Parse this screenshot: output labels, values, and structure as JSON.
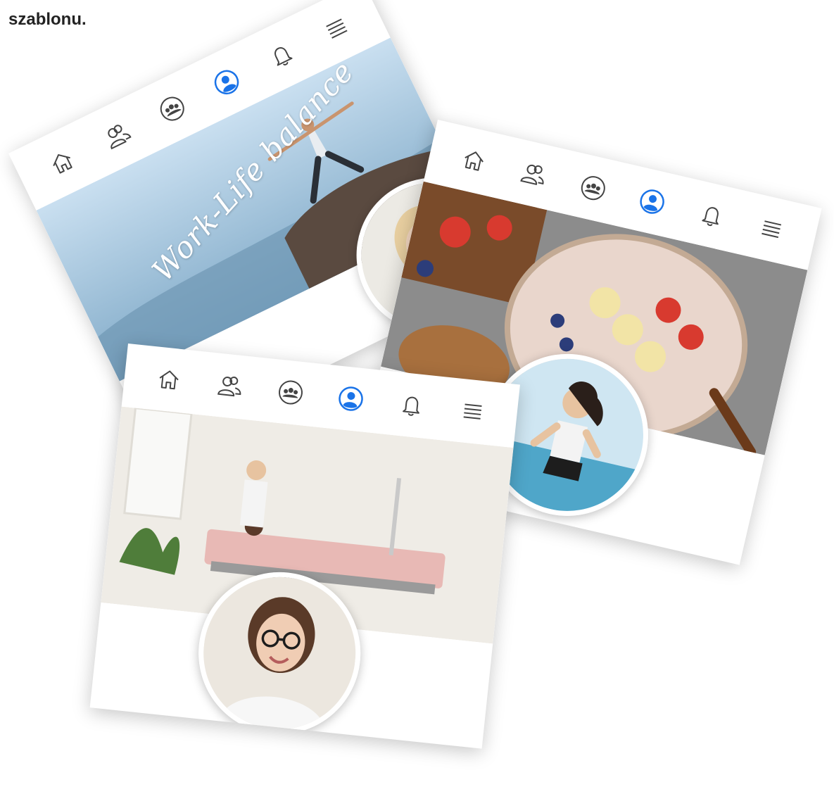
{
  "caption": "szablonu.",
  "colors": {
    "accent": "#1a73e8",
    "icon": "#444444"
  },
  "nav_icons": [
    "home-icon",
    "friends-icon",
    "groups-icon",
    "profile-icon",
    "bell-icon",
    "menu-icon"
  ],
  "cards": [
    {
      "name": "yoga",
      "cover_text": "Work-Life balance",
      "cover": "yoga",
      "avatar": "blonde-woman-with-glasses"
    },
    {
      "name": "food",
      "cover_text": "",
      "cover": "smoothie-bowl",
      "avatar": "woman-running"
    },
    {
      "name": "beauty",
      "cover_text": "",
      "cover": "beauty-clinic",
      "avatar": "woman-with-glasses"
    }
  ]
}
